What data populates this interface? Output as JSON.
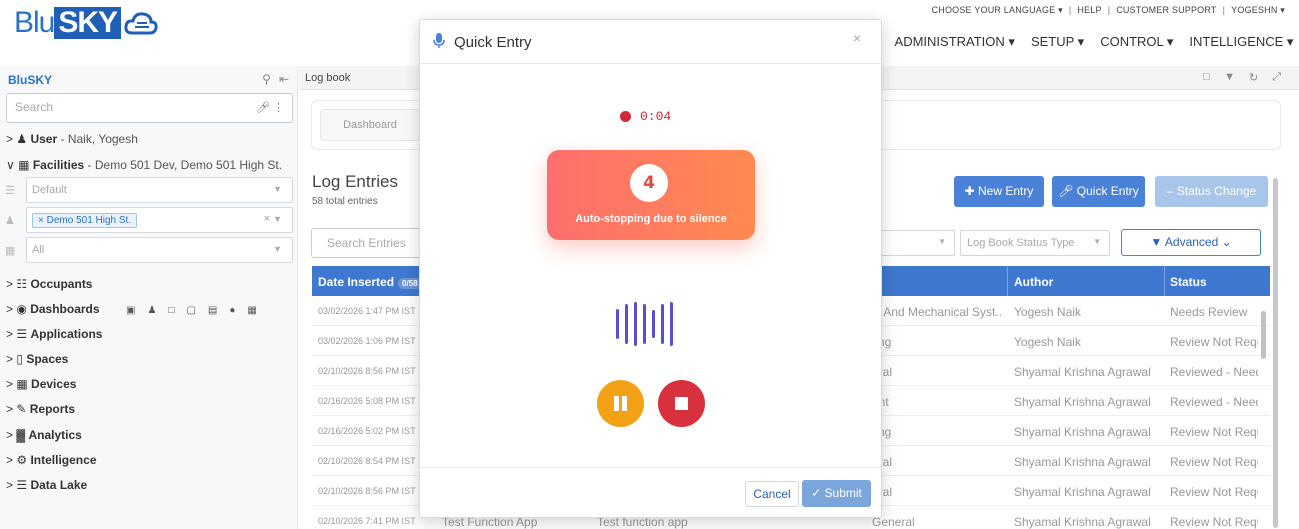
{
  "brand": {
    "blu": "Blu",
    "sky": "SKY"
  },
  "topbar": {
    "language": "CHOOSE YOUR LANGUAGE ▾",
    "help": "HELP",
    "support": "CUSTOMER SUPPORT",
    "user": "YOGESHN ▾",
    "sep": "|"
  },
  "mainnav": [
    "▾",
    "ADMINISTRATION ▾",
    "SETUP ▾",
    "CONTROL ▾",
    "INTELLIGENCE ▾"
  ],
  "sidebar": {
    "title": "BluSKY",
    "search_placeholder": "Search",
    "user_label": "User",
    "user_value": "- Naik, Yogesh",
    "facilities_label": "Facilities",
    "facilities_value": "- Demo 501 Dev, Demo 501 High St.",
    "select_default": "Default",
    "select_chip": "Demo 501 High St.",
    "select_all": "All",
    "items": [
      {
        "label": "Occupants"
      },
      {
        "label": "Dashboards"
      },
      {
        "label": "Applications"
      },
      {
        "label": "Spaces"
      },
      {
        "label": "Devices"
      },
      {
        "label": "Reports"
      },
      {
        "label": "Analytics"
      },
      {
        "label": "Intelligence"
      },
      {
        "label": "Data Lake"
      }
    ]
  },
  "main": {
    "breadcrumb": "Log book",
    "dashboard_tab": "Dashboard",
    "title": "Log Entries",
    "count": "58 total entries",
    "btn_new": "New Entry",
    "btn_quick": "Quick Entry",
    "btn_status": "Status Change",
    "search_placeholder": "Search Entries",
    "status_type_placeholder": "Log Book Status Type",
    "advanced": "Advanced",
    "columns": {
      "date": "Date Inserted",
      "date_badge": "0/58",
      "type": "e",
      "author": "Author",
      "status": "Status"
    },
    "rows": [
      {
        "date": "03/02/2026 1:47 PM IST",
        "type": "C And Mechanical Syst...",
        "author": "Yogesh Naik",
        "status": "Needs Review"
      },
      {
        "date": "03/02/2026 1:06 PM IST",
        "type": "ting",
        "author": "Yogesh Naik",
        "status": "Review Not Requi"
      },
      {
        "date": "02/10/2026 8:56 PM IST",
        "type": "eral",
        "author": "Shyamal Krishna Agrawal",
        "status": "Reviewed - Needs"
      },
      {
        "date": "02/16/2026 5:08 PM IST",
        "type": "ent",
        "author": "Shyamal Krishna Agrawal",
        "status": "Reviewed - Needs"
      },
      {
        "date": "02/16/2026 5:02 PM IST",
        "type": "ting",
        "author": "Shyamal Krishna Agrawal",
        "status": "Review Not Requi"
      },
      {
        "date": "02/10/2026 8:54 PM IST",
        "type": "eral",
        "author": "Shyamal Krishna Agrawal",
        "status": "Review Not Requi"
      },
      {
        "date": "02/10/2026 8:56 PM IST",
        "type": "eral",
        "author": "Shyamal Krishna Agrawal",
        "status": "Review Not Requi"
      },
      {
        "date": "02/10/2026 7:41 PM IST",
        "app": "Test Function App",
        "app2": "Test function app",
        "type": "General",
        "author": "Shyamal Krishna Agrawal",
        "status": "Review Not Requi"
      }
    ]
  },
  "modal": {
    "title": "Quick Entry",
    "close": "×",
    "timer": "0:04",
    "countdown": "4",
    "silence_message": "Auto-stopping due to silence",
    "cancel": "Cancel",
    "submit": "Submit"
  },
  "colors": {
    "primary": "#4a82d8",
    "record_red": "#d0293a",
    "pause_orange": "#f4a215",
    "wave_purple": "#5a4fcf"
  }
}
